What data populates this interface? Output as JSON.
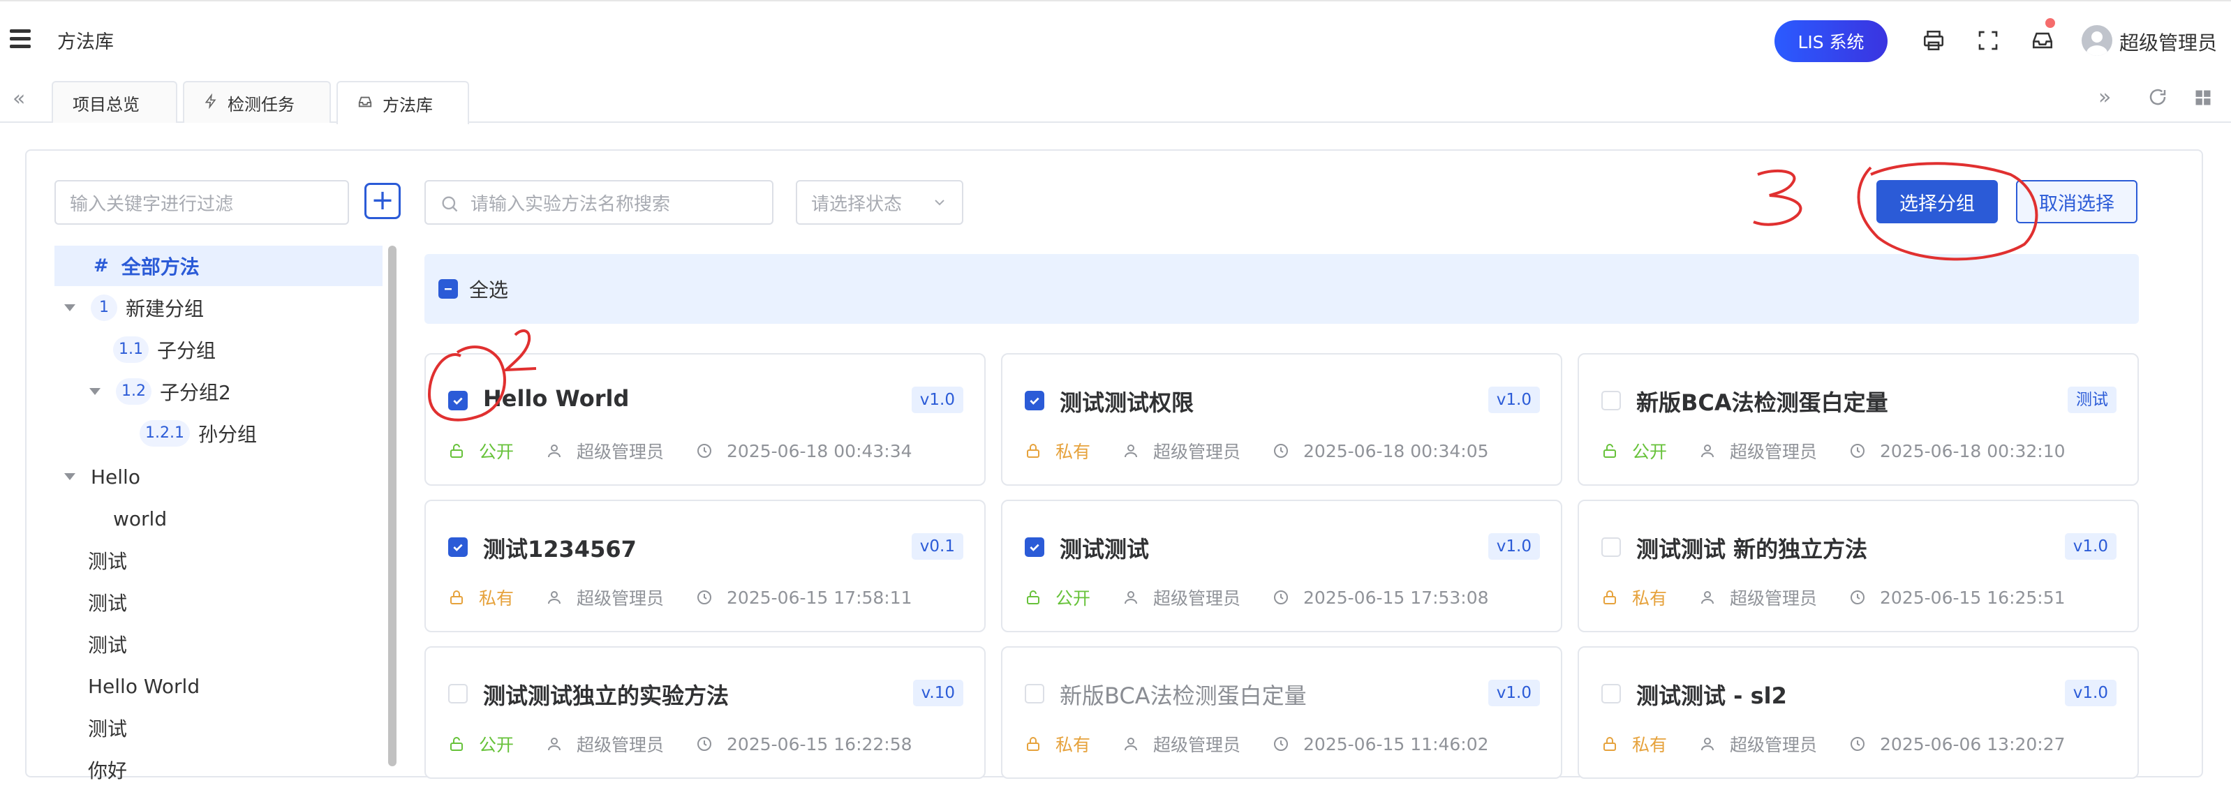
{
  "header": {
    "title": "方法库",
    "lis_button": "LIS 系统",
    "user_name": "超级管理员"
  },
  "tabs": [
    {
      "label": "项目总览",
      "icon": "none"
    },
    {
      "label": "检测任务",
      "icon": "bolt-icon"
    },
    {
      "label": "方法库",
      "icon": "inbox-icon"
    }
  ],
  "filter": {
    "keyword_placeholder": "输入关键字进行过滤",
    "search_placeholder": "请输入实验方法名称搜索",
    "status_placeholder": "请选择状态"
  },
  "tree": {
    "items": [
      {
        "badge": "#",
        "label": "全部方法"
      },
      {
        "badge": "1",
        "label": "新建分组"
      },
      {
        "badge": "1.1",
        "label": "子分组"
      },
      {
        "badge": "1.2",
        "label": "子分组2"
      },
      {
        "badge": "1.2.1",
        "label": "孙分组"
      },
      {
        "badge": "",
        "label": "Hello"
      },
      {
        "badge": "",
        "label": "world"
      },
      {
        "badge": "",
        "label": "测试"
      },
      {
        "badge": "",
        "label": "测试"
      },
      {
        "badge": "",
        "label": "测试"
      },
      {
        "badge": "",
        "label": "Hello World"
      },
      {
        "badge": "",
        "label": "测试"
      },
      {
        "badge": "",
        "label": "你好"
      }
    ]
  },
  "actions": {
    "select_group": "选择分组",
    "cancel_select": "取消选择",
    "select_all": "全选"
  },
  "cards": [
    {
      "title": "Hello World",
      "version": "v1.0",
      "visibility": "公开",
      "owner": "超级管理员",
      "time": "2025-06-18 00:43:34",
      "checked": true
    },
    {
      "title": "测试测试权限",
      "version": "v1.0",
      "visibility": "私有",
      "owner": "超级管理员",
      "time": "2025-06-18 00:34:05",
      "checked": true
    },
    {
      "title": "新版BCA法检测蛋白定量",
      "version": "测试",
      "visibility": "公开",
      "owner": "超级管理员",
      "time": "2025-06-18 00:32:10",
      "checked": false
    },
    {
      "title": "测试1234567",
      "version": "v0.1",
      "visibility": "私有",
      "owner": "超级管理员",
      "time": "2025-06-15 17:58:11",
      "checked": true
    },
    {
      "title": "测试测试",
      "version": "v1.0",
      "visibility": "公开",
      "owner": "超级管理员",
      "time": "2025-06-15 17:53:08",
      "checked": true
    },
    {
      "title": "测试测试 新的独立方法",
      "version": "v1.0",
      "visibility": "私有",
      "owner": "超级管理员",
      "time": "2025-06-15 16:25:51",
      "checked": false
    },
    {
      "title": "测试测试独立的实验方法",
      "version": "v.10",
      "visibility": "公开",
      "owner": "超级管理员",
      "time": "2025-06-15 16:22:58",
      "checked": false
    },
    {
      "title": "新版BCA法检测蛋白定量",
      "version": "v1.0",
      "visibility": "私有",
      "owner": "超级管理员",
      "time": "2025-06-15 11:46:02",
      "checked": false
    },
    {
      "title": "测试测试 - sl2",
      "version": "v1.0",
      "visibility": "私有",
      "owner": "超级管理员",
      "time": "2025-06-06 13:20:27",
      "checked": false
    }
  ],
  "annotations": {
    "label_2": "2",
    "label_3": "3"
  },
  "colors": {
    "primary": "#2b5bd7",
    "public": "#67c23a",
    "private": "#e6a23c",
    "annotation": "#e03030"
  }
}
